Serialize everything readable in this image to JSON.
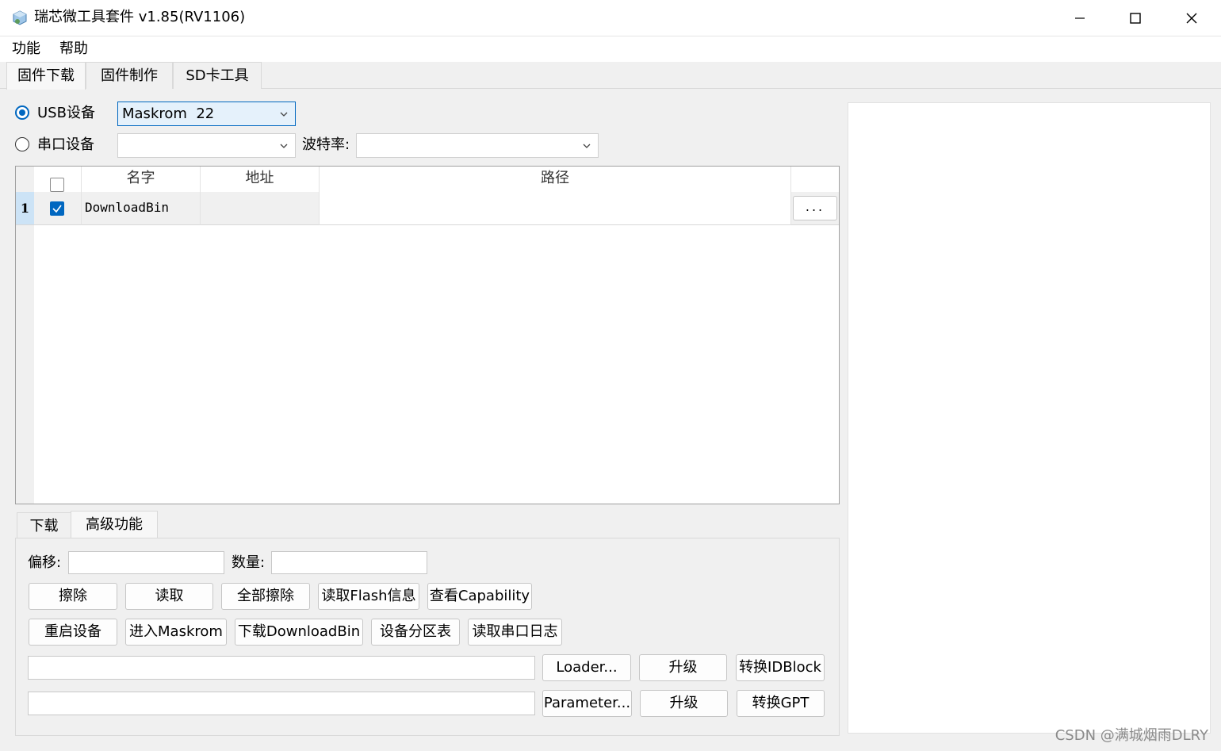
{
  "window": {
    "title": "瑞芯微工具套件 v1.85(RV1106)",
    "minimize": "minimize-icon",
    "maximize": "maximize-icon",
    "close": "close-icon"
  },
  "menu": {
    "items": [
      "功能",
      "帮助"
    ]
  },
  "main_tabs": [
    {
      "label": "固件下载",
      "active": true
    },
    {
      "label": "固件制作",
      "active": false
    },
    {
      "label": "SD卡工具",
      "active": false
    }
  ],
  "device": {
    "usb_label": "USB设备",
    "usb_selected": "Maskrom  22",
    "serial_label": "串口设备",
    "serial_value": "",
    "baud_label": "波特率:",
    "baud_value": ""
  },
  "table": {
    "headers": [
      "名字",
      "地址",
      "路径"
    ],
    "rows": [
      {
        "index": "1",
        "checked": true,
        "name": "DownloadBin",
        "address": "",
        "path": "",
        "browse": "..."
      }
    ]
  },
  "sub_tabs": [
    {
      "label": "下载",
      "active": false
    },
    {
      "label": "高级功能",
      "active": true
    }
  ],
  "advanced": {
    "offset_label": "偏移:",
    "offset_value": "",
    "count_label": "数量:",
    "count_value": "",
    "row1_buttons": [
      "擦除",
      "读取",
      "全部擦除",
      "读取Flash信息",
      "查看Capability"
    ],
    "row2_buttons": [
      "重启设备",
      "进入Maskrom",
      "下载DownloadBin",
      "设备分区表",
      "读取串口日志"
    ],
    "loader_path": "",
    "loader_button": "Loader...",
    "loader_upgrade": "升级",
    "convert_idblock": "转换IDBlock",
    "parameter_path": "",
    "parameter_button": "Parameter...",
    "parameter_upgrade": "升级",
    "convert_gpt": "转换GPT"
  },
  "watermark": "CSDN @满城烟雨DLRY",
  "colors": {
    "accent": "#0067c0",
    "selected_field_bg": "#e5f1fb"
  }
}
